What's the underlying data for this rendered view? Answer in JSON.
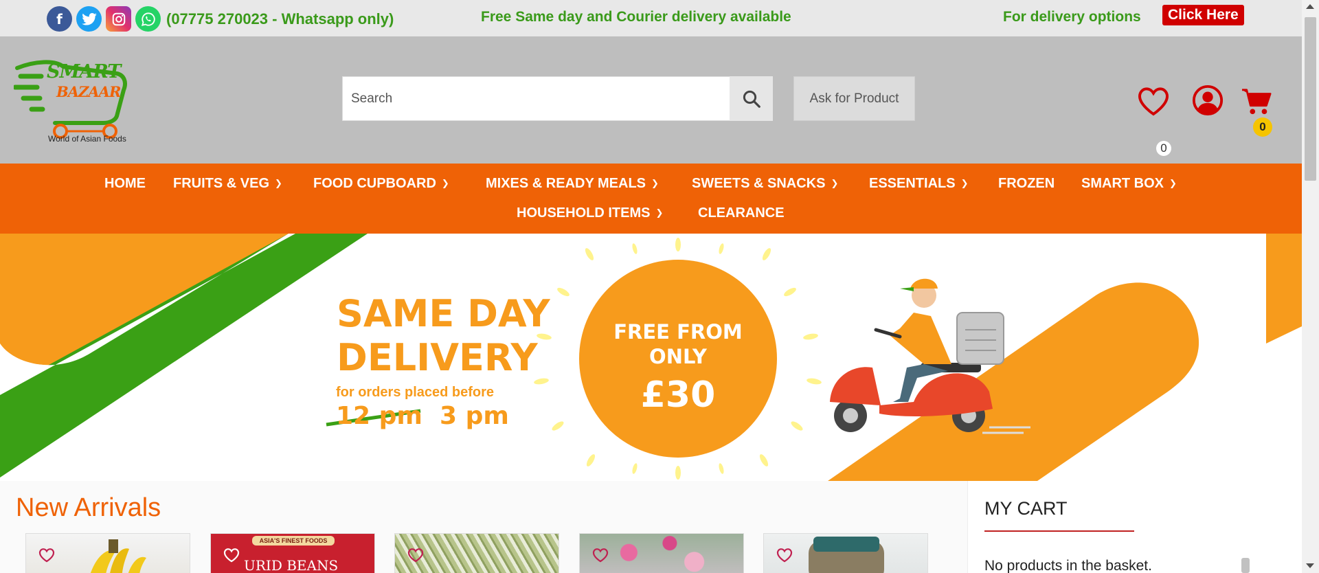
{
  "topbar": {
    "phone": "(07775 270023 - Whatsapp only)",
    "free_delivery": "Free Same day and Courier delivery available",
    "delivery_options": "For delivery options",
    "click_here": "Click Here"
  },
  "header": {
    "logo_line1": "SMART",
    "logo_line2": "BAZAAR",
    "logo_tagline": "World of Asian Foods",
    "search_placeholder": "Search",
    "ask_for_product": "Ask for Product",
    "wishlist_count": "0",
    "cart_count": "0"
  },
  "nav": {
    "items": [
      {
        "label": "HOME"
      },
      {
        "label": "FRUITS & VEG"
      },
      {
        "label": "FOOD CUPBOARD"
      },
      {
        "label": "MIXES & READY MEALS"
      },
      {
        "label": "SWEETS & SNACKS"
      },
      {
        "label": "ESSENTIALS"
      },
      {
        "label": "FROZEN"
      },
      {
        "label": "SMART BOX"
      },
      {
        "label": "HOUSEHOLD ITEMS"
      },
      {
        "label": "CLEARANCE"
      }
    ]
  },
  "banner": {
    "headline_line1": "SAME DAY",
    "headline_line2": "DELIVERY",
    "sub": "for orders placed before",
    "old_time": "12 pm",
    "new_time": "3 pm",
    "circle_line1": "FREE FROM",
    "circle_line2": "ONLY",
    "price": "£30"
  },
  "section": {
    "new_arrivals": "New Arrivals",
    "product2_label": "URID BEANS",
    "product2_brand": "ASIA'S FINEST FOODS"
  },
  "cart": {
    "title": "MY CART",
    "empty": "No products in the basket."
  },
  "colors": {
    "brand_orange": "#ef6206",
    "brand_green": "#3a9a1a",
    "banner_orange": "#f79b1c",
    "banner_green": "#3aa015",
    "alert_red": "#d00000"
  }
}
